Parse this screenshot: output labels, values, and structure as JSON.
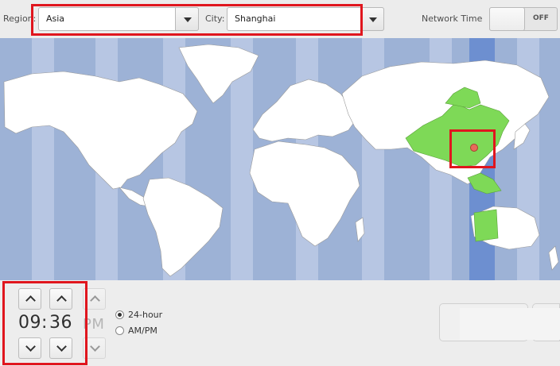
{
  "header": {
    "region_label": "Region:",
    "region_value": "Asia",
    "city_label": "City:",
    "city_value": "Shanghai",
    "network_time_label": "Network Time",
    "network_time_state": "OFF"
  },
  "map": {
    "selected_city": "Shanghai",
    "ocean_color": "#9db2d6",
    "land_color": "#ffffff",
    "highlight_zone_color": "#7ed957",
    "selected_band_color": "#6d8fd0",
    "marker_color": "#e66b5b"
  },
  "time": {
    "hours": "09",
    "separator": ":",
    "minutes": "36",
    "ampm": "PM"
  },
  "format": {
    "option_24h": "24-hour",
    "option_ampm": "AM/PM",
    "selected": "24-hour"
  },
  "annotation_color": "#e0161e"
}
